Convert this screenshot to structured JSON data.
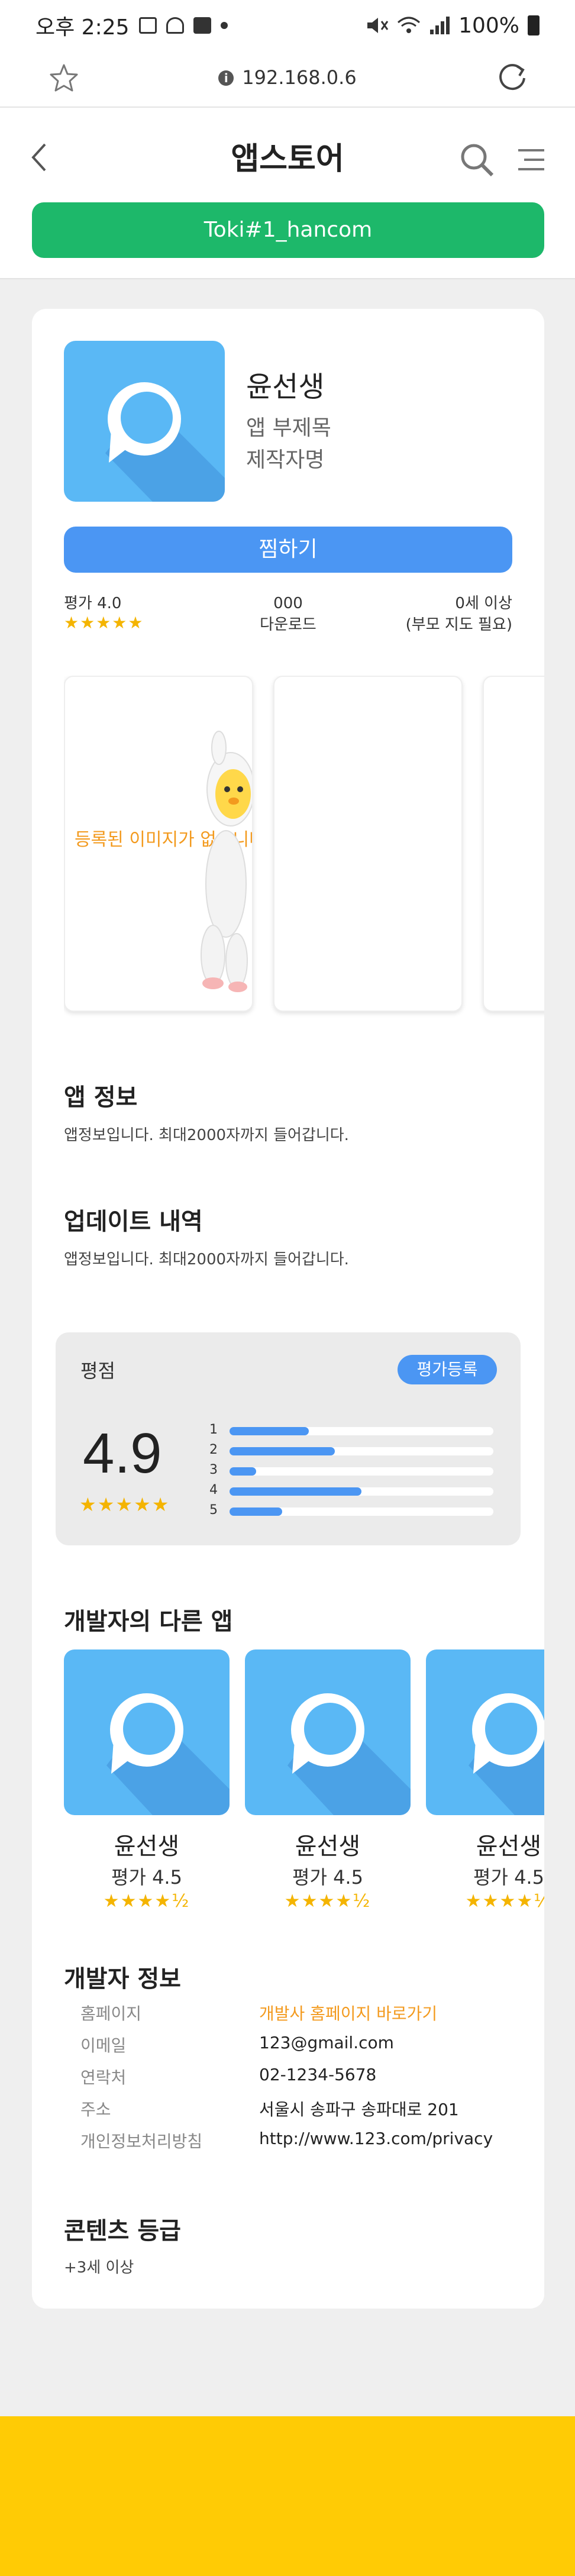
{
  "status_bar": {
    "time": "오후 2:25",
    "battery": "100%",
    "icons": [
      "gallery-icon",
      "weather-icon",
      "app-badge-icon",
      "mute-icon",
      "wifi-icon",
      "signal-icon",
      "battery-icon"
    ]
  },
  "browser": {
    "url": "192.168.0.6",
    "icons": [
      "bookmark-star-icon",
      "info-icon",
      "reload-icon"
    ]
  },
  "header": {
    "title": "앱스토어",
    "user_button": "Toki#1_hancom",
    "icons": [
      "back-icon",
      "search-icon",
      "menu-icon"
    ]
  },
  "app": {
    "name": "윤선생",
    "subtitle": "앱 부제목",
    "author": "제작자명",
    "wish_button": "찜하기",
    "rating_label": "평가 4.0",
    "rating_stars": "★★★★★",
    "downloads_value": "000",
    "downloads_label": "다운로드",
    "age_value": "0세 이상",
    "age_note": "(부모 지도 필요)",
    "icon_color": "#5ab8f5"
  },
  "screenshots": {
    "placeholder_text": "등록된 이미지가 없습니다"
  },
  "app_info": {
    "title": "앱 정보",
    "body": "앱정보입니다. 최대2000자까지 들어갑니다."
  },
  "update_history": {
    "title": "업데이트 내역",
    "body": "앱정보입니다. 최대2000자까지 들어갑니다."
  },
  "rating": {
    "label": "평점",
    "register_button": "평가등록",
    "score": "4.9",
    "stars": "★★★★★",
    "distribution": [
      {
        "star": "1",
        "fraction": 0.3
      },
      {
        "star": "2",
        "fraction": 0.4
      },
      {
        "star": "3",
        "fraction": 0.1
      },
      {
        "star": "4",
        "fraction": 0.5
      },
      {
        "star": "5",
        "fraction": 0.2
      }
    ]
  },
  "other_apps": {
    "title": "개발자의 다른 앱",
    "items": [
      {
        "name": "윤선생",
        "rating": "평가 4.5",
        "stars": "★★★★½"
      },
      {
        "name": "윤선생",
        "rating": "평가 4.5",
        "stars": "★★★★½"
      },
      {
        "name": "윤선생",
        "rating": "평가 4.5",
        "stars": "★★★★½"
      }
    ]
  },
  "developer": {
    "title": "개발자 정보",
    "rows": [
      {
        "key": "홈페이지",
        "value": "개발사 홈페이지 바로가기"
      },
      {
        "key": "이메일",
        "value": "123@gmail.com"
      },
      {
        "key": "연락처",
        "value": "02-1234-5678"
      },
      {
        "key": "주소",
        "value": "서울시 송파구 송파대로 201"
      },
      {
        "key": "개인정보처리방침",
        "value": "http://www.123.com/privacy"
      }
    ]
  },
  "content_rating": {
    "title": "콘텐츠 등급",
    "value": "+3세 이상"
  },
  "colors": {
    "green": "#1db86a",
    "blue": "#4b96f3",
    "star": "#f4b400",
    "orange_link": "#f39a1e",
    "footer_yellow": "#ffcb05"
  }
}
